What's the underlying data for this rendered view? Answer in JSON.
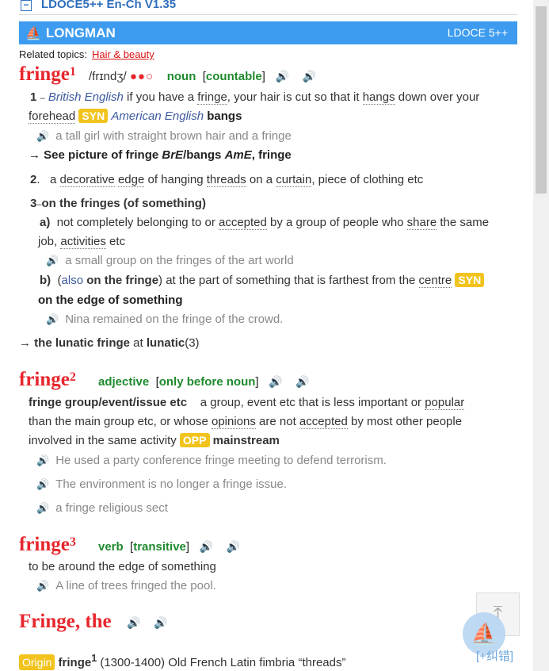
{
  "dict_title": "LDOCE5++ En-Ch V1.35",
  "banner": {
    "brand": "LONGMAN",
    "version": "LDOCE 5++"
  },
  "related": {
    "label": "Related topics:",
    "link": "Hair & beauty"
  },
  "entries": {
    "e1": {
      "word": "fringe",
      "num": "1",
      "pron": "/frɪndʒ/",
      "freq": "●●○",
      "pos": "noun",
      "gram": "countable"
    },
    "e2": {
      "word": "fringe",
      "num": "2",
      "pos": "adjective",
      "gram": "only before noun"
    },
    "e3": {
      "word": "fringe",
      "num": "3",
      "pos": "verb",
      "gram": "transitive"
    },
    "e4": {
      "word": "Fringe, the"
    }
  },
  "senses": {
    "s1": {
      "num": "1",
      "dash": "–",
      "region1": "British English",
      "t1": " if you have a ",
      "w1": "fringe",
      "t2": ", your hair is cut so that it ",
      "w2": "hangs",
      "t3": " down over your",
      "w3": "forehead",
      "syn": "SYN",
      "region2": "American English",
      "bold": "bangs",
      "ex": "a tall girl with straight brown hair and a fringe",
      "see_arrow": "→",
      "see_text": "See picture of fringe",
      "see_bre": "BrE",
      "see_slash": "/bangs ",
      "see_ame": "AmE",
      "see_end": ", fringe"
    },
    "s2": {
      "num": "2",
      "dot": ".",
      "t1": "a ",
      "w1": "decorative",
      "t2": " ",
      "w2": "edge",
      "t3": " of hanging ",
      "w3": "threads",
      "t4": " on a ",
      "w4": "curtain",
      "t5": ", piece of clothing etc"
    },
    "s3": {
      "num": "3",
      "dash": "–",
      "phrase": "on the fringes (of something)",
      "a_label": "a)",
      "a_t1": "not completely belonging to or ",
      "a_w1": "accepted",
      "a_t2": " by a group of people who ",
      "a_w2": "share",
      "a_t3": " the same",
      "a_l2_t1": "job, ",
      "a_l2_w1": "activities",
      "a_l2_t2": " etc",
      "a_ex": "a small group on the fringes of the art world",
      "b_label": "b)",
      "b_open": "(",
      "b_also": "also",
      "b_phrase": " on the fringe",
      "b_close": ")",
      "b_t1": " at the part of something that is farthest from the ",
      "b_w1": "centre",
      "b_syn": "SYN",
      "b_bold": "on the edge of something",
      "b_ex": "Nina remained on the fringe of the crowd."
    },
    "lunatic": {
      "arrow": "→",
      "phrase": "the lunatic fringe",
      "at": " at ",
      "ref": "lunatic",
      "num": "(3)"
    },
    "adj": {
      "phrase": "fringe group/event/issue etc",
      "t1": "a group, event etc that is less important or ",
      "w1": "popular",
      "l2": "than the main group etc, or whose ",
      "l2w1": "opinions",
      "l2t2": " are not ",
      "l2w2": "accepted",
      "l2t3": " by most other people",
      "l3": "involved in the same activity ",
      "opp": "OPP",
      "bold": "mainstream",
      "ex1": "He used a party conference fringe meeting to defend terrorism.",
      "ex2": "The environment is no longer a fringe issue.",
      "ex3": "a fringe religious sect"
    },
    "verb": {
      "def": "to be around the edge of something",
      "ex": "A line of trees fringed the pool."
    }
  },
  "origin": {
    "label": "Origin",
    "word": "fringe",
    "num": "1",
    "text": " (1300-1400) Old French Latin fimbria “threads”"
  },
  "fix_link": "[+纠错]",
  "speaker_glyph": "🔊",
  "colors": {
    "headword": "#e8262d",
    "pos": "#1f8a2e",
    "banner": "#3d9cf0",
    "syn": "#f2c31c"
  }
}
